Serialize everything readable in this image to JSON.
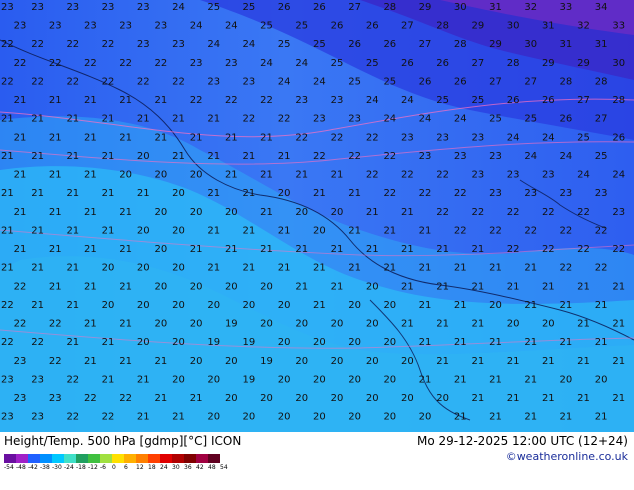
{
  "footer": {
    "title": "Height/Temp. 500 hPa [gdmp][°C] ICON",
    "datetime": "Mo 29-12-2025 12:00 UTC (12+24)",
    "credit": "©weatheronline.co.uk"
  },
  "scale": {
    "ticks": [
      "-54",
      "-48",
      "-42",
      "-38",
      "-30",
      "-24",
      "-18",
      "-12",
      "-6",
      "0",
      "6",
      "12",
      "18",
      "24",
      "30",
      "36",
      "42",
      "48",
      "54"
    ],
    "colors": [
      "#6a0fa0",
      "#a020c8",
      "#2060ff",
      "#0090ff",
      "#00c8ff",
      "#40e0c8",
      "#20a060",
      "#40c040",
      "#a0e040",
      "#ffe000",
      "#ffb000",
      "#ff8000",
      "#ff4000",
      "#e00000",
      "#b00000",
      "#800000",
      "#a00040",
      "#600020"
    ]
  },
  "map": {
    "contour_labels": [
      {
        "row": 0,
        "values": [
          "23",
          "23",
          "23",
          "23",
          "23",
          "24",
          "25",
          "25",
          "26",
          "26",
          "27",
          "28",
          "29",
          "30",
          "31",
          "32",
          "33",
          "34"
        ]
      },
      {
        "row": 1,
        "values": [
          "23",
          "23",
          "23",
          "23",
          "23",
          "24",
          "24",
          "25",
          "25",
          "26",
          "26",
          "27",
          "28",
          "29",
          "30",
          "31",
          "32",
          "33"
        ]
      },
      {
        "row": 2,
        "values": [
          "22",
          "22",
          "22",
          "22",
          "23",
          "23",
          "24",
          "24",
          "25",
          "25",
          "26",
          "26",
          "27",
          "28",
          "29",
          "30",
          "31",
          "31"
        ]
      },
      {
        "row": 3,
        "values": [
          "22",
          "22",
          "22",
          "22",
          "22",
          "23",
          "23",
          "24",
          "24",
          "25",
          "25",
          "26",
          "26",
          "27",
          "28",
          "29",
          "29",
          "30"
        ]
      },
      {
        "row": 4,
        "values": [
          "22",
          "22",
          "22",
          "22",
          "22",
          "22",
          "23",
          "23",
          "24",
          "24",
          "25",
          "25",
          "26",
          "26",
          "27",
          "27",
          "28",
          "28"
        ]
      },
      {
        "row": 5,
        "values": [
          "21",
          "21",
          "21",
          "21",
          "21",
          "22",
          "22",
          "22",
          "23",
          "23",
          "24",
          "24",
          "25",
          "25",
          "26",
          "26",
          "27",
          "28"
        ]
      },
      {
        "row": 6,
        "values": [
          "21",
          "21",
          "21",
          "21",
          "21",
          "21",
          "21",
          "22",
          "22",
          "23",
          "23",
          "24",
          "24",
          "24",
          "25",
          "25",
          "26",
          "27"
        ]
      },
      {
        "row": 7,
        "values": [
          "21",
          "21",
          "21",
          "21",
          "21",
          "21",
          "21",
          "21",
          "22",
          "22",
          "22",
          "23",
          "23",
          "23",
          "24",
          "24",
          "25",
          "26"
        ]
      },
      {
        "row": 8,
        "values": [
          "21",
          "21",
          "21",
          "21",
          "20",
          "21",
          "21",
          "21",
          "21",
          "22",
          "22",
          "22",
          "23",
          "23",
          "23",
          "24",
          "24",
          "25"
        ]
      },
      {
        "row": 9,
        "values": [
          "21",
          "21",
          "21",
          "20",
          "20",
          "20",
          "21",
          "21",
          "21",
          "21",
          "22",
          "22",
          "22",
          "23",
          "23",
          "23",
          "24",
          "24"
        ]
      },
      {
        "row": 10,
        "values": [
          "21",
          "21",
          "21",
          "21",
          "21",
          "20",
          "21",
          "21",
          "20",
          "21",
          "21",
          "22",
          "22",
          "22",
          "23",
          "23",
          "23",
          "23"
        ]
      },
      {
        "row": 11,
        "values": [
          "21",
          "21",
          "21",
          "21",
          "20",
          "20",
          "20",
          "21",
          "20",
          "20",
          "21",
          "21",
          "22",
          "22",
          "22",
          "22",
          "22",
          "23"
        ]
      },
      {
        "row": 12,
        "values": [
          "21",
          "21",
          "21",
          "21",
          "20",
          "20",
          "21",
          "21",
          "21",
          "20",
          "21",
          "21",
          "21",
          "22",
          "22",
          "22",
          "22",
          "22"
        ]
      },
      {
        "row": 13,
        "values": [
          "21",
          "21",
          "21",
          "21",
          "20",
          "21",
          "21",
          "21",
          "21",
          "21",
          "21",
          "21",
          "21",
          "21",
          "22",
          "22",
          "22",
          "22"
        ]
      },
      {
        "row": 14,
        "values": [
          "21",
          "21",
          "21",
          "20",
          "20",
          "20",
          "21",
          "21",
          "21",
          "21",
          "21",
          "21",
          "21",
          "21",
          "21",
          "21",
          "22",
          "22"
        ]
      },
      {
        "row": 15,
        "values": [
          "22",
          "21",
          "21",
          "21",
          "20",
          "20",
          "20",
          "20",
          "21",
          "21",
          "20",
          "21",
          "21",
          "21",
          "21",
          "21",
          "21",
          "21"
        ]
      },
      {
        "row": 16,
        "values": [
          "22",
          "21",
          "21",
          "20",
          "20",
          "20",
          "20",
          "20",
          "20",
          "21",
          "20",
          "20",
          "21",
          "21",
          "20",
          "21",
          "21",
          "21"
        ]
      },
      {
        "row": 17,
        "values": [
          "22",
          "22",
          "21",
          "21",
          "20",
          "20",
          "19",
          "20",
          "20",
          "20",
          "20",
          "21",
          "21",
          "21",
          "20",
          "20",
          "21",
          "21"
        ]
      },
      {
        "row": 18,
        "values": [
          "22",
          "22",
          "21",
          "21",
          "20",
          "20",
          "19",
          "19",
          "20",
          "20",
          "20",
          "20",
          "21",
          "21",
          "21",
          "21",
          "21",
          "21"
        ]
      },
      {
        "row": 19,
        "values": [
          "23",
          "22",
          "21",
          "21",
          "21",
          "20",
          "20",
          "19",
          "20",
          "20",
          "20",
          "20",
          "21",
          "21",
          "21",
          "21",
          "21",
          "21"
        ]
      },
      {
        "row": 20,
        "values": [
          "23",
          "23",
          "22",
          "21",
          "21",
          "20",
          "20",
          "19",
          "20",
          "20",
          "20",
          "20",
          "21",
          "21",
          "21",
          "21",
          "20",
          "20"
        ]
      },
      {
        "row": 21,
        "values": [
          "23",
          "23",
          "22",
          "22",
          "21",
          "21",
          "20",
          "20",
          "20",
          "20",
          "20",
          "20",
          "20",
          "21",
          "21",
          "21",
          "21",
          "21"
        ]
      },
      {
        "row": 22,
        "values": [
          "23",
          "23",
          "22",
          "22",
          "21",
          "21",
          "20",
          "20",
          "20",
          "20",
          "20",
          "20",
          "20",
          "21",
          "21",
          "21",
          "21",
          "21"
        ]
      }
    ]
  }
}
